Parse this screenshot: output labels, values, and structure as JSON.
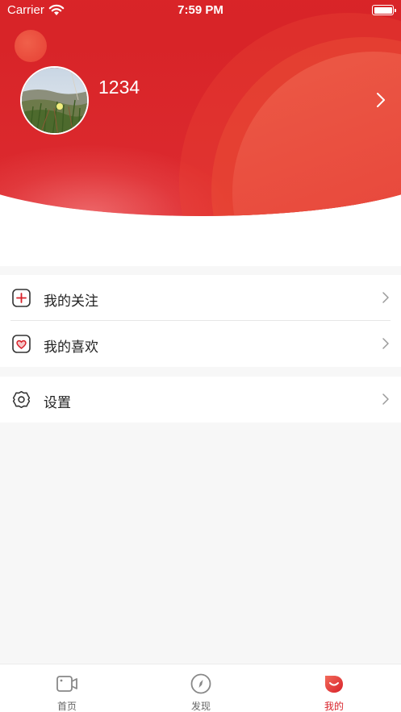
{
  "status_bar": {
    "carrier": "Carrier",
    "time": "7:59 PM"
  },
  "profile": {
    "username": "1234"
  },
  "menu": {
    "group1": [
      {
        "label": "我的关注",
        "icon": "plus-square-icon"
      },
      {
        "label": "我的喜欢",
        "icon": "heart-square-icon"
      }
    ],
    "group2": [
      {
        "label": "设置",
        "icon": "gear-icon"
      }
    ]
  },
  "tabbar": {
    "tabs": [
      {
        "label": "首页",
        "icon": "video-camera-icon",
        "active": false
      },
      {
        "label": "发现",
        "icon": "compass-icon",
        "active": false
      },
      {
        "label": "我的",
        "icon": "profile-icon",
        "active": true
      }
    ]
  },
  "colors": {
    "brand_red": "#d8222a",
    "background": "#f7f7f7"
  }
}
